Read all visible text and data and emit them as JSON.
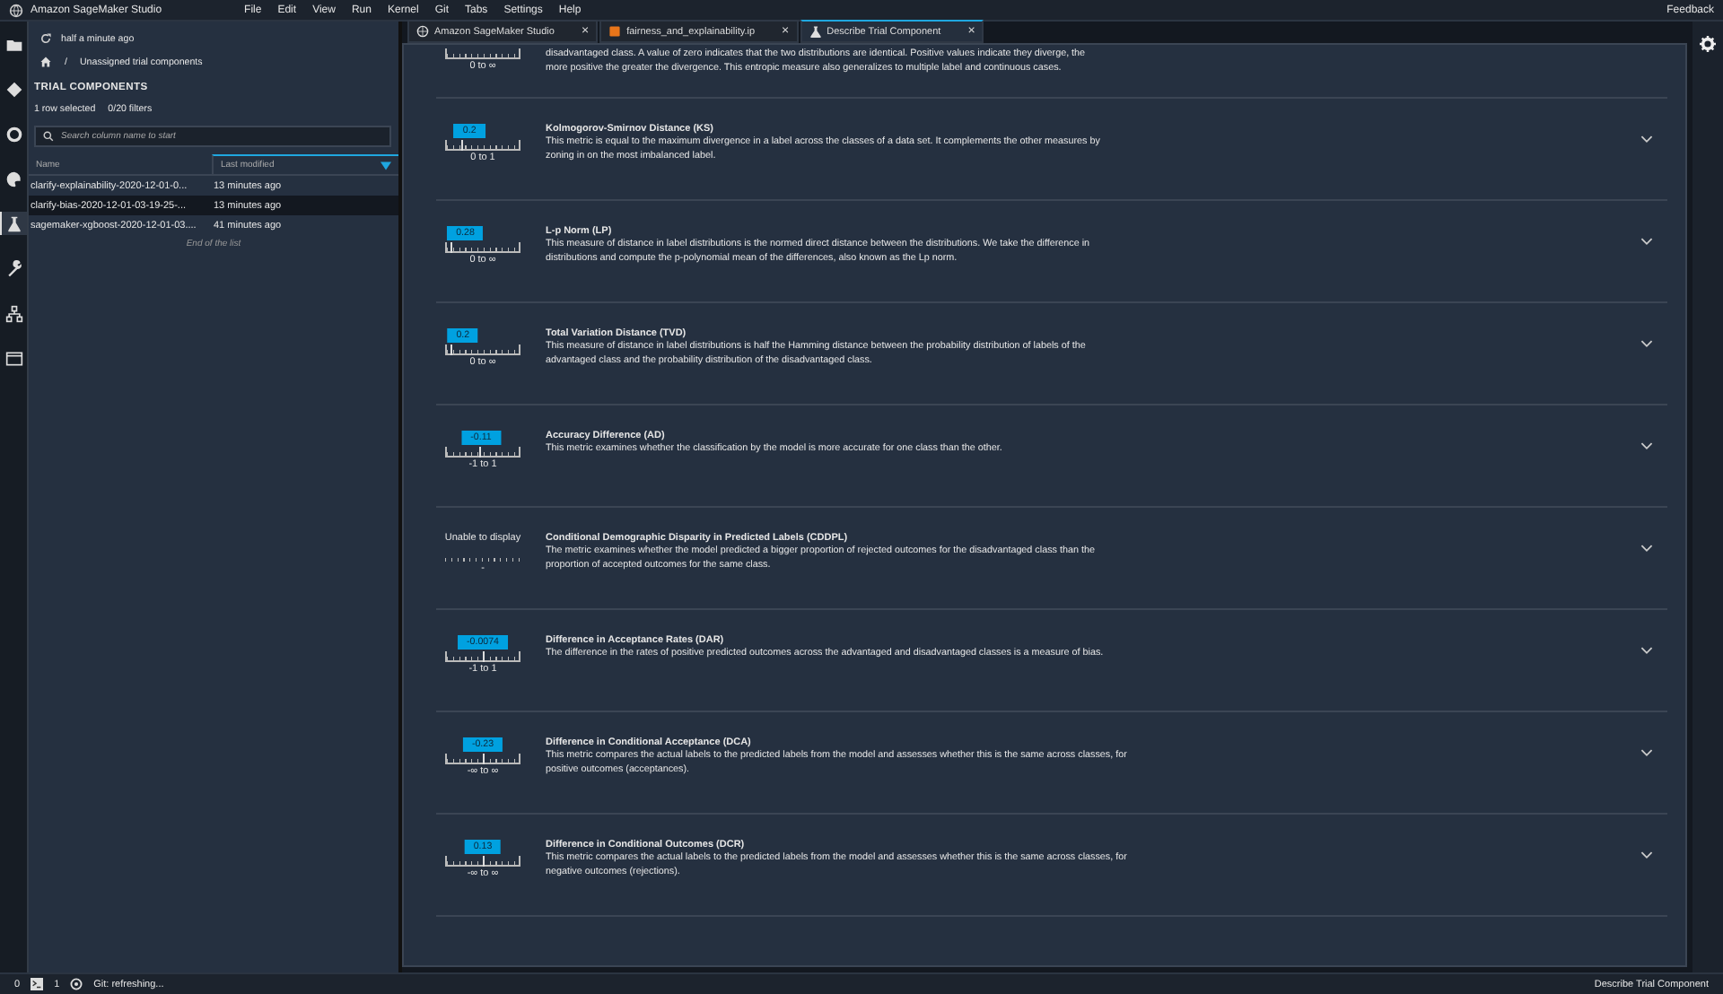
{
  "menubar": {
    "app_title": "Amazon SageMaker Studio",
    "menus": [
      "File",
      "Edit",
      "View",
      "Run",
      "Kernel",
      "Git",
      "Tabs",
      "Settings",
      "Help"
    ],
    "feedback": "Feedback"
  },
  "activity_bar": [
    {
      "kind": "folder",
      "selected": false
    },
    {
      "kind": "git",
      "selected": false
    },
    {
      "kind": "stop",
      "selected": false
    },
    {
      "kind": "palette",
      "selected": false
    },
    {
      "kind": "flask",
      "selected": true
    },
    {
      "kind": "wrench",
      "selected": false
    },
    {
      "kind": "network",
      "selected": false
    },
    {
      "kind": "window",
      "selected": false
    }
  ],
  "left_panel": {
    "refresh_text": "half a minute ago",
    "breadcrumb_separator": "/",
    "breadcrumb": "Unassigned trial components",
    "heading": "TRIAL COMPONENTS",
    "selection_count": "1 row selected",
    "filters": "0/20 filters",
    "search": {
      "placeholder": "Search column name to start"
    },
    "table": {
      "columns": [
        {
          "label": "Name",
          "sorted": false
        },
        {
          "label": "Last modified",
          "sorted": true
        }
      ],
      "rows": [
        {
          "name": "clarify-explainability-2020-12-01-0...",
          "modified": "13 minutes ago",
          "selected": false
        },
        {
          "name": "clarify-bias-2020-12-01-03-19-25-...",
          "modified": "13 minutes ago",
          "selected": true
        },
        {
          "name": "sagemaker-xgboost-2020-12-01-03....",
          "modified": "41 minutes ago",
          "selected": false
        }
      ],
      "footer": "End of the list"
    }
  },
  "tabs": [
    {
      "label": "Amazon SageMaker Studio",
      "kind": "studio",
      "close": "×",
      "selected": false
    },
    {
      "label": "fairness_and_explainability.ip",
      "kind": "notebook",
      "close": "×",
      "selected": false
    },
    {
      "label": "Describe Trial Component",
      "kind": "flask",
      "close": "×",
      "selected": true
    }
  ],
  "metrics": [
    {
      "kind": "partial",
      "range": "0 to ∞",
      "lines": [
        "disadvantaged class. A value of zero indicates that the two distributions are identical. Positive values indicate they diverge, the",
        "more positive the greater the divergence. This entropic measure also generalizes to multiple label and continuous cases."
      ]
    },
    {
      "kind": "value",
      "value": "0.2",
      "level": 0.2,
      "range": "0 to 1",
      "title": "Kolmogorov-Smirnov Distance (KS)",
      "description": "This metric is equal to the maximum divergence in a label across the classes of a data set. It complements the other measures by zoning in on the most imbalanced label."
    },
    {
      "kind": "value",
      "value": "0.28",
      "level": 0.05,
      "range": "0 to ∞",
      "title": "L-p Norm (LP)",
      "description": "This measure of distance in label distributions is the normed direct distance between the distributions. We take the difference in distributions and compute the p-polynomial mean of the differences, also known as the Lp norm."
    },
    {
      "kind": "value",
      "value": "0.2",
      "level": 0.05,
      "range": "0 to ∞",
      "title": "Total Variation Distance (TVD)",
      "description": "This measure of distance in label distributions is half the Hamming distance between the probability distribution of labels of the advantaged class and the probability distribution of the disadvantaged class."
    },
    {
      "kind": "value",
      "value": "-0.11",
      "level": 0.45,
      "range": "-1 to 1",
      "title": "Accuracy Difference (AD)",
      "description": "This metric examines whether the classification by the model is more accurate for one class than the other."
    },
    {
      "kind": "unavailable",
      "value": "Unable to display",
      "range": "-",
      "title": "Conditional Demographic Disparity in Predicted Labels (CDDPL)",
      "description": "The metric examines whether the model predicted a bigger proportion of rejected outcomes for the disadvantaged class than the proportion of accepted outcomes for the same class."
    },
    {
      "kind": "value",
      "value": "-0.0074",
      "level": 0.5,
      "range": "-1 to 1",
      "title": "Difference in Acceptance Rates (DAR)",
      "description": "The difference in the rates of positive predicted outcomes across the advantaged and disadvantaged classes is a measure of bias."
    },
    {
      "kind": "value",
      "value": "-0.23",
      "level": 0.5,
      "range": "-∞ to ∞",
      "title": "Difference in Conditional Acceptance (DCA)",
      "description": "This metric compares the actual labels to the predicted labels from the model and assesses whether this is the same across classes, for positive outcomes (acceptances)."
    },
    {
      "kind": "value",
      "value": "0.13",
      "level": 0.5,
      "range": "-∞ to ∞",
      "title": "Difference in Conditional Outcomes (DCR)",
      "description": "This metric compares the actual labels to the predicted labels from the model and assesses whether this is the same across classes, for negative outcomes (rejections)."
    }
  ],
  "status_bar": {
    "left_count": "0",
    "terminal_count": "1",
    "git_status": "Git: refreshing...",
    "right_text": "Describe Trial Component"
  }
}
